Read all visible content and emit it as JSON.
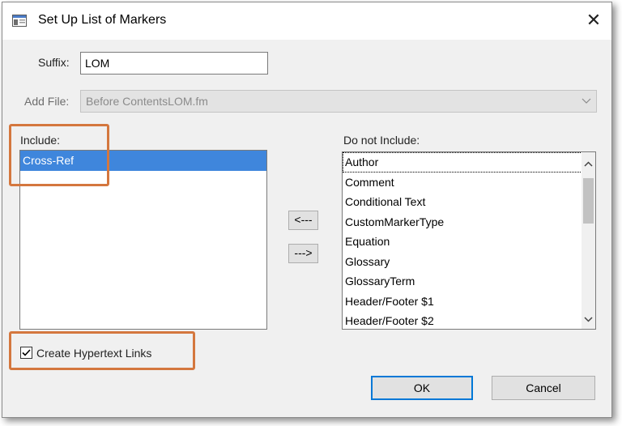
{
  "dialog": {
    "title": "Set Up List of Markers",
    "close_label": "✕"
  },
  "suffix": {
    "label": "Suffix:",
    "value": "LOM"
  },
  "add_file": {
    "label": "Add File:",
    "value": "Before ContentsLOM.fm"
  },
  "include": {
    "label": "Include:",
    "items": [
      "Cross-Ref"
    ]
  },
  "exclude": {
    "label": "Do not Include:",
    "items": [
      "Author",
      "Comment",
      "Conditional Text",
      "CustomMarkerType",
      "Equation",
      "Glossary",
      "GlossaryTerm",
      "Header/Footer $1",
      "Header/Footer $2"
    ]
  },
  "move_buttons": {
    "add_label": "<---",
    "remove_label": "--->"
  },
  "hypertext": {
    "label": "Create Hypertext Links",
    "checked": true
  },
  "buttons": {
    "ok_label": "OK",
    "cancel_label": "Cancel"
  },
  "colors": {
    "selection": "#3f86dc",
    "highlight_box": "#d4773e",
    "default_button_border": "#0078d7"
  }
}
